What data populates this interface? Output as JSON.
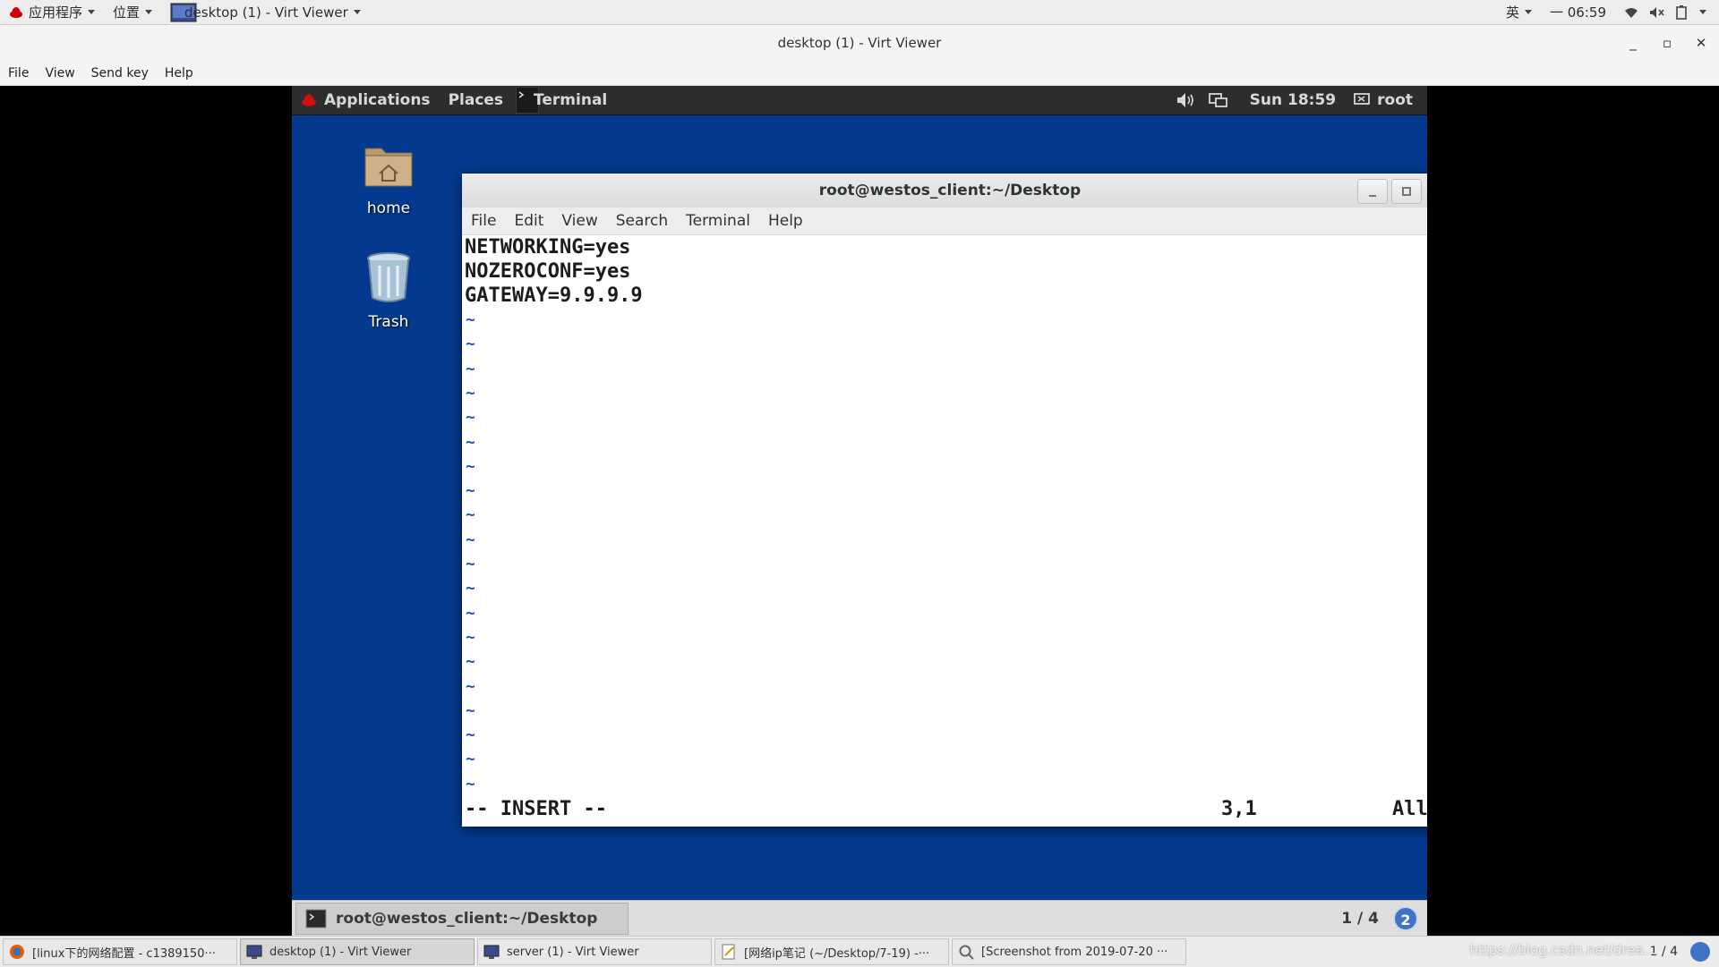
{
  "host_topbar": {
    "applications": "应用程序",
    "places": "位置",
    "window": "desktop (1) - Virt Viewer",
    "input_method": "英",
    "time": "一 06:59"
  },
  "viewer": {
    "title": "desktop (1) - Virt Viewer",
    "menu": [
      "File",
      "View",
      "Send key",
      "Help"
    ]
  },
  "guest": {
    "topbar": {
      "applications": "Applications",
      "places": "Places",
      "terminal": "Terminal",
      "clock": "Sun 18:59",
      "user": "root"
    },
    "desktop_icons": [
      "home",
      "Trash"
    ],
    "terminal": {
      "title": "root@westos_client:~/Desktop",
      "menu": [
        "File",
        "Edit",
        "View",
        "Search",
        "Terminal",
        "Help"
      ],
      "lines": [
        "NETWORKING=yes",
        "NOZEROCONF=yes",
        "GATEWAY=9.9.9.9"
      ],
      "tilde": "~",
      "mode": "-- INSERT --",
      "position": "3,1",
      "scroll": "All"
    },
    "bottom_bar": {
      "task": "root@westos_client:~/Desktop",
      "workspace": "1 / 4",
      "notifications": "2"
    }
  },
  "host_taskbar": {
    "tasks": [
      "[linux下的网络配置 - c1389150···",
      "desktop (1) - Virt Viewer",
      "server (1) - Virt Viewer",
      "[网络ip笔记 (~/Desktop/7-19) -···",
      "[Screenshot from 2019-07-20 ···"
    ],
    "pager": "1 / 4",
    "watermark": "https://blog.csdn.net/drea..."
  },
  "colors": {
    "guest_desktop": "#033a8f",
    "vim_tilde": "#2b4fc8",
    "guest_topbar": "#2d2d2d"
  }
}
